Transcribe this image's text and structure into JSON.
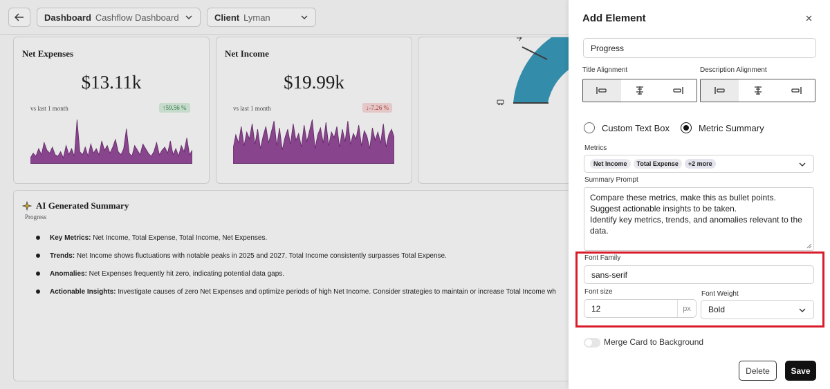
{
  "topbar": {
    "dashboard_label": "Dashboard",
    "dashboard_value": "Cashflow Dashboard",
    "client_label": "Client",
    "client_value": "Lyman"
  },
  "cards": [
    {
      "title": "Net Expenses",
      "value": "$13.11k",
      "comparison": "vs last 1 month",
      "change": "↑59.56 %",
      "trend": "up",
      "series": [
        3,
        6,
        4,
        9,
        5,
        13,
        8,
        6,
        10,
        5,
        4,
        7,
        3,
        11,
        5,
        9,
        4,
        28,
        7,
        5,
        10,
        4,
        12,
        6,
        9,
        5,
        14,
        8,
        11,
        6,
        10,
        15,
        7,
        5,
        9,
        22,
        6,
        4,
        11,
        8,
        5,
        12,
        9,
        6,
        4,
        7,
        13,
        5,
        8,
        10,
        6,
        14,
        5,
        9,
        4,
        11,
        7,
        16,
        5,
        8
      ]
    },
    {
      "title": "Net Income",
      "value": "$19.99k",
      "comparison": "vs last 1 month",
      "change": "↓-7.26 %",
      "trend": "down",
      "series": [
        10,
        20,
        14,
        26,
        12,
        22,
        17,
        28,
        13,
        24,
        10,
        19,
        26,
        14,
        22,
        30,
        12,
        25,
        9,
        18,
        24,
        13,
        28,
        16,
        21,
        11,
        27,
        15,
        23,
        31,
        10,
        20,
        25,
        14,
        29,
        12,
        22,
        18,
        26,
        11,
        24,
        15,
        30,
        13,
        21,
        17,
        27,
        12,
        23,
        19,
        10,
        25,
        16,
        22,
        14,
        28,
        11,
        20,
        24,
        18
      ]
    }
  ],
  "summary": {
    "title": "AI Generated Summary",
    "subtitle": "Progress",
    "bullets": [
      {
        "label": "Key Metrics:",
        "text": " Net Income, Total Expense, Total Income, Net Expenses."
      },
      {
        "label": "Trends:",
        "text": " Net Income shows fluctuations with notable peaks in 2025 and 2027. Total Income consistently surpasses Total Expense."
      },
      {
        "label": "Anomalies:",
        "text": " Net Expenses frequently hit zero, indicating potential data gaps."
      },
      {
        "label": "Actionable Insights:",
        "text": " Investigate causes of zero Net Expenses and optimize periods of high Net Income. Consider strategies to maintain or increase Total Income wh"
      }
    ]
  },
  "panel": {
    "title": "Add Element",
    "element_title_value": "Progress",
    "title_alignment_label": "Title Alignment",
    "description_alignment_label": "Description Alignment",
    "content_options": [
      "Custom Text Box",
      "Metric Summary"
    ],
    "selected_content": "Metric Summary",
    "metrics_label": "Metrics",
    "metrics_chips": [
      "Net Income",
      "Total Expense",
      "+2 more"
    ],
    "summary_prompt_label": "Summary Prompt",
    "summary_prompt_lines": [
      "Compare these metrics, make this as bullet points.",
      "Suggest actionable insights to be taken.",
      "Identify key metrics, trends, and anomalies relevant to the",
      "data."
    ],
    "font_family_label": "Font Family",
    "font_family_value": "sans-serif",
    "font_size_label": "Font size",
    "font_size_value": "12",
    "font_size_unit": "px",
    "font_weight_label": "Font Weight",
    "font_weight_value": "Bold",
    "merge_label": "Merge Card to Background",
    "merge_enabled": false,
    "delete_label": "Delete",
    "save_label": "Save"
  },
  "colors": {
    "sparkline_fill": "#8a3d8f",
    "gauge": "#2a8fb0",
    "highlight": "#d81c2a",
    "badge_up_bg": "#d2e9d8",
    "badge_down_bg": "#f3d3d3"
  }
}
